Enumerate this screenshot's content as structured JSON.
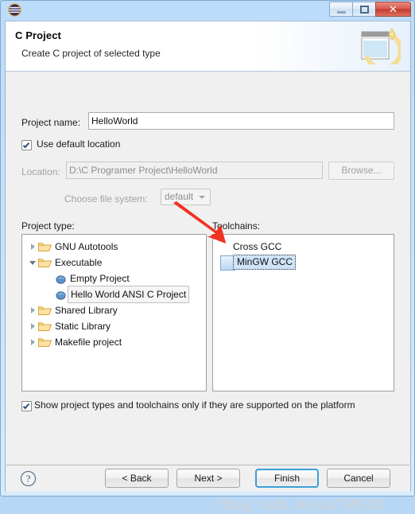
{
  "window": {
    "app_icon": "eclipse-icon",
    "buttons": {
      "minimize": "minimize-icon",
      "maximize": "maximize-icon",
      "close": "✕"
    }
  },
  "header": {
    "title": "C Project",
    "description": "Create C project of selected type",
    "banner_icon": "wizard-banner-icon"
  },
  "form": {
    "project_name_label": "Project name:",
    "project_name_value": "HelloWorld",
    "use_default_location_label": "Use default location",
    "use_default_location_checked": true,
    "location_label": "Location:",
    "location_value": "D:\\C Programer Project\\HelloWorld",
    "browse_label": "Browse...",
    "file_system_label": "Choose file system:",
    "file_system_value": "default",
    "file_system_options": [
      "default"
    ]
  },
  "project_type": {
    "label": "Project type:",
    "items": [
      {
        "label": "GNU Autotools",
        "level": 0,
        "icon": "folder-icon",
        "expander": "collapsed",
        "selected": false
      },
      {
        "label": "Executable",
        "level": 0,
        "icon": "folder-icon",
        "expander": "expanded",
        "selected": false
      },
      {
        "label": "Empty Project",
        "level": 1,
        "icon": "blue-dot-icon",
        "expander": "none",
        "selected": false
      },
      {
        "label": "Hello World ANSI C Project",
        "level": 1,
        "icon": "blue-dot-icon",
        "expander": "none",
        "selected": true
      },
      {
        "label": "Shared Library",
        "level": 0,
        "icon": "folder-icon",
        "expander": "collapsed",
        "selected": false
      },
      {
        "label": "Static Library",
        "level": 0,
        "icon": "folder-icon",
        "expander": "collapsed",
        "selected": false
      },
      {
        "label": "Makefile project",
        "level": 0,
        "icon": "folder-icon",
        "expander": "collapsed",
        "selected": false
      }
    ]
  },
  "toolchains": {
    "label": "Toolchains:",
    "items": [
      {
        "label": "Cross GCC",
        "selected": false
      },
      {
        "label": "MinGW GCC",
        "selected": true
      }
    ]
  },
  "options": {
    "show_supported_label": "Show project types and toolchains only if they are supported on the platform",
    "show_supported_checked": true
  },
  "footer": {
    "help_icon": "help-icon",
    "back_label": "< Back",
    "next_label": "Next >",
    "finish_label": "Finish",
    "cancel_label": "Cancel"
  },
  "annotation": {
    "arrow": "red-arrow-annotation",
    "watermark": "//blog. csdn. net/su749520"
  },
  "colors": {
    "accent": "#3c9fd6",
    "close_button": "#c0392b",
    "selection": "#cfe3f8",
    "annotation_red": "#f03222",
    "dialog_bg": "#f0f0f0"
  }
}
